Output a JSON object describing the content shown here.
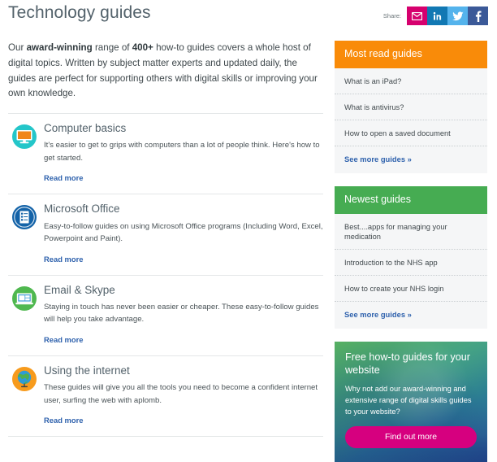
{
  "header": {
    "title": "Technology guides",
    "share_label": "Share:",
    "share_buttons": [
      {
        "name": "email-share-button",
        "icon": "envelope-icon",
        "color": "#d6006e"
      },
      {
        "name": "linkedin-share-button",
        "icon": "linkedin-icon",
        "color": "#1178b3"
      },
      {
        "name": "twitter-share-button",
        "icon": "twitter-bird-icon",
        "color": "#54b3ec"
      },
      {
        "name": "facebook-share-button",
        "icon": "facebook-f-icon",
        "color": "#3b5998"
      }
    ]
  },
  "main": {
    "intro": {
      "part1": "Our ",
      "bold1": "award-winning",
      "part2": " range of ",
      "bold2": "400+",
      "part3": " how-to guides covers a whole host of digital topics. Written by subject matter experts and updated daily, the guides are perfect for supporting others with digital skills or improving your own knowledge."
    },
    "guides": [
      {
        "icon": "monitor-icon",
        "icon_circle_color": "#24c6c9",
        "title": "Computer basics",
        "desc": "It's easier to get to grips with computers than a lot of people think. Here's how to get started.",
        "link": "Read more"
      },
      {
        "icon": "document-icon",
        "icon_circle_color": "#1463a8",
        "title": "Microsoft Office",
        "desc": "Easy-to-follow guides on using Microsoft Office programs (Including Word, Excel, Powerpoint and Paint).",
        "link": "Read more"
      },
      {
        "icon": "laptop-video-call-icon",
        "icon_circle_color": "#4fb84f",
        "title": "Email & Skype",
        "desc": "Staying in touch has never been easier or cheaper. These easy-to-follow guides will help you take advantage.",
        "link": "Read more"
      },
      {
        "icon": "globe-icon",
        "icon_circle_color": "#f79b1d",
        "title": "Using the internet",
        "desc": "These guides will give you all the tools you need to become a confident internet user, surfing the web with aplomb.",
        "link": "Read more"
      }
    ]
  },
  "sidebar": {
    "most_read": {
      "heading": "Most read guides",
      "heading_color": "#f98b09",
      "items": [
        "What is an iPad?",
        "What is antivirus?",
        "How to open a saved document"
      ],
      "more_link": "See more guides »"
    },
    "newest": {
      "heading": "Newest guides",
      "heading_color": "#46ac52",
      "items": [
        "Best....apps for managing your medication",
        "Introduction to the NHS app",
        "How to create your NHS login"
      ],
      "more_link": "See more guides »"
    },
    "promo": {
      "title": "Free how-to guides for your website",
      "text": "Why not add our award-winning and extensive range of digital skills guides to your website?",
      "button_label": "Find out more",
      "button_color": "#d6007f"
    }
  }
}
